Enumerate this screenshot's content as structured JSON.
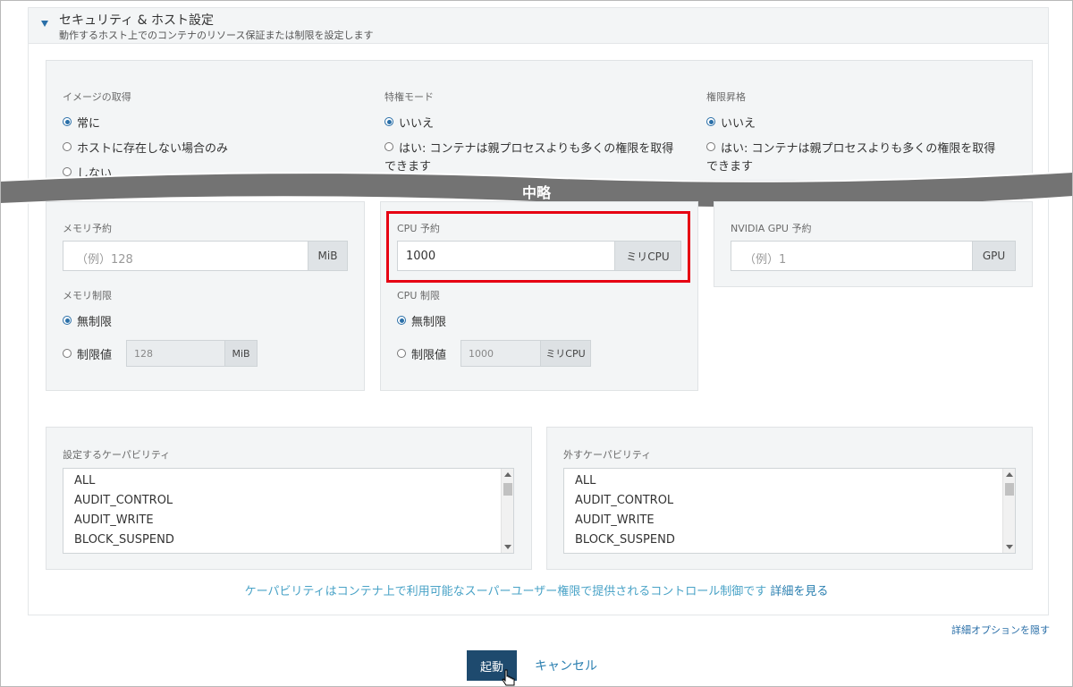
{
  "section": {
    "title": "セキュリティ & ホスト設定",
    "subtitle": "動作するホスト上でのコンテナのリソース保証または制限を設定します"
  },
  "image_pull": {
    "label": "イメージの取得",
    "options": [
      "常に",
      "ホストに存在しない場合のみ",
      "しない"
    ],
    "selected": 0
  },
  "privileged": {
    "label": "特権モード",
    "options": [
      "いいえ",
      "はい: コンテナは親プロセスよりも多くの権限を取得",
      "できます"
    ],
    "selected": 0
  },
  "escalation": {
    "label": "権限昇格",
    "options": [
      "いいえ",
      "はい: コンテナは親プロセスよりも多くの権限を取得",
      "できます"
    ],
    "selected": 0
  },
  "omitted_label": "中略",
  "memory": {
    "reserve_label": "メモリ予約",
    "reserve_placeholder": "（例）128",
    "reserve_unit": "MiB",
    "limit_label": "メモリ制限",
    "unlimited": "無制限",
    "limit_value_label": "制限値",
    "limit_value": "128",
    "limit_unit": "MiB"
  },
  "cpu": {
    "reserve_label": "CPU 予約",
    "reserve_value": "1000",
    "reserve_unit": "ミリCPU",
    "limit_label": "CPU 制限",
    "unlimited": "無制限",
    "limit_value_label": "制限値",
    "limit_value": "1000",
    "limit_unit": "ミリCPU"
  },
  "gpu": {
    "reserve_label": "NVIDIA GPU 予約",
    "reserve_placeholder": "（例）1",
    "reserve_unit": "GPU"
  },
  "cap_add": {
    "label": "設定するケーパビリティ",
    "items": [
      "ALL",
      "AUDIT_CONTROL",
      "AUDIT_WRITE",
      "BLOCK_SUSPEND"
    ]
  },
  "cap_drop": {
    "label": "外すケーパビリティ",
    "items": [
      "ALL",
      "AUDIT_CONTROL",
      "AUDIT_WRITE",
      "BLOCK_SUSPEND"
    ]
  },
  "help": {
    "text": "ケーパビリティはコンテナ上で利用可能なスーパーユーザー権限で提供されるコントロール制御です ",
    "link": "詳細を見る"
  },
  "hide_advanced": "詳細オプションを隠す",
  "buttons": {
    "launch": "起動",
    "cancel": "キャンセル"
  },
  "colors": {
    "accent": "#2a6fa8",
    "launch_bg": "#1e4a6e",
    "highlight": "#e60012",
    "band": "#737373"
  }
}
